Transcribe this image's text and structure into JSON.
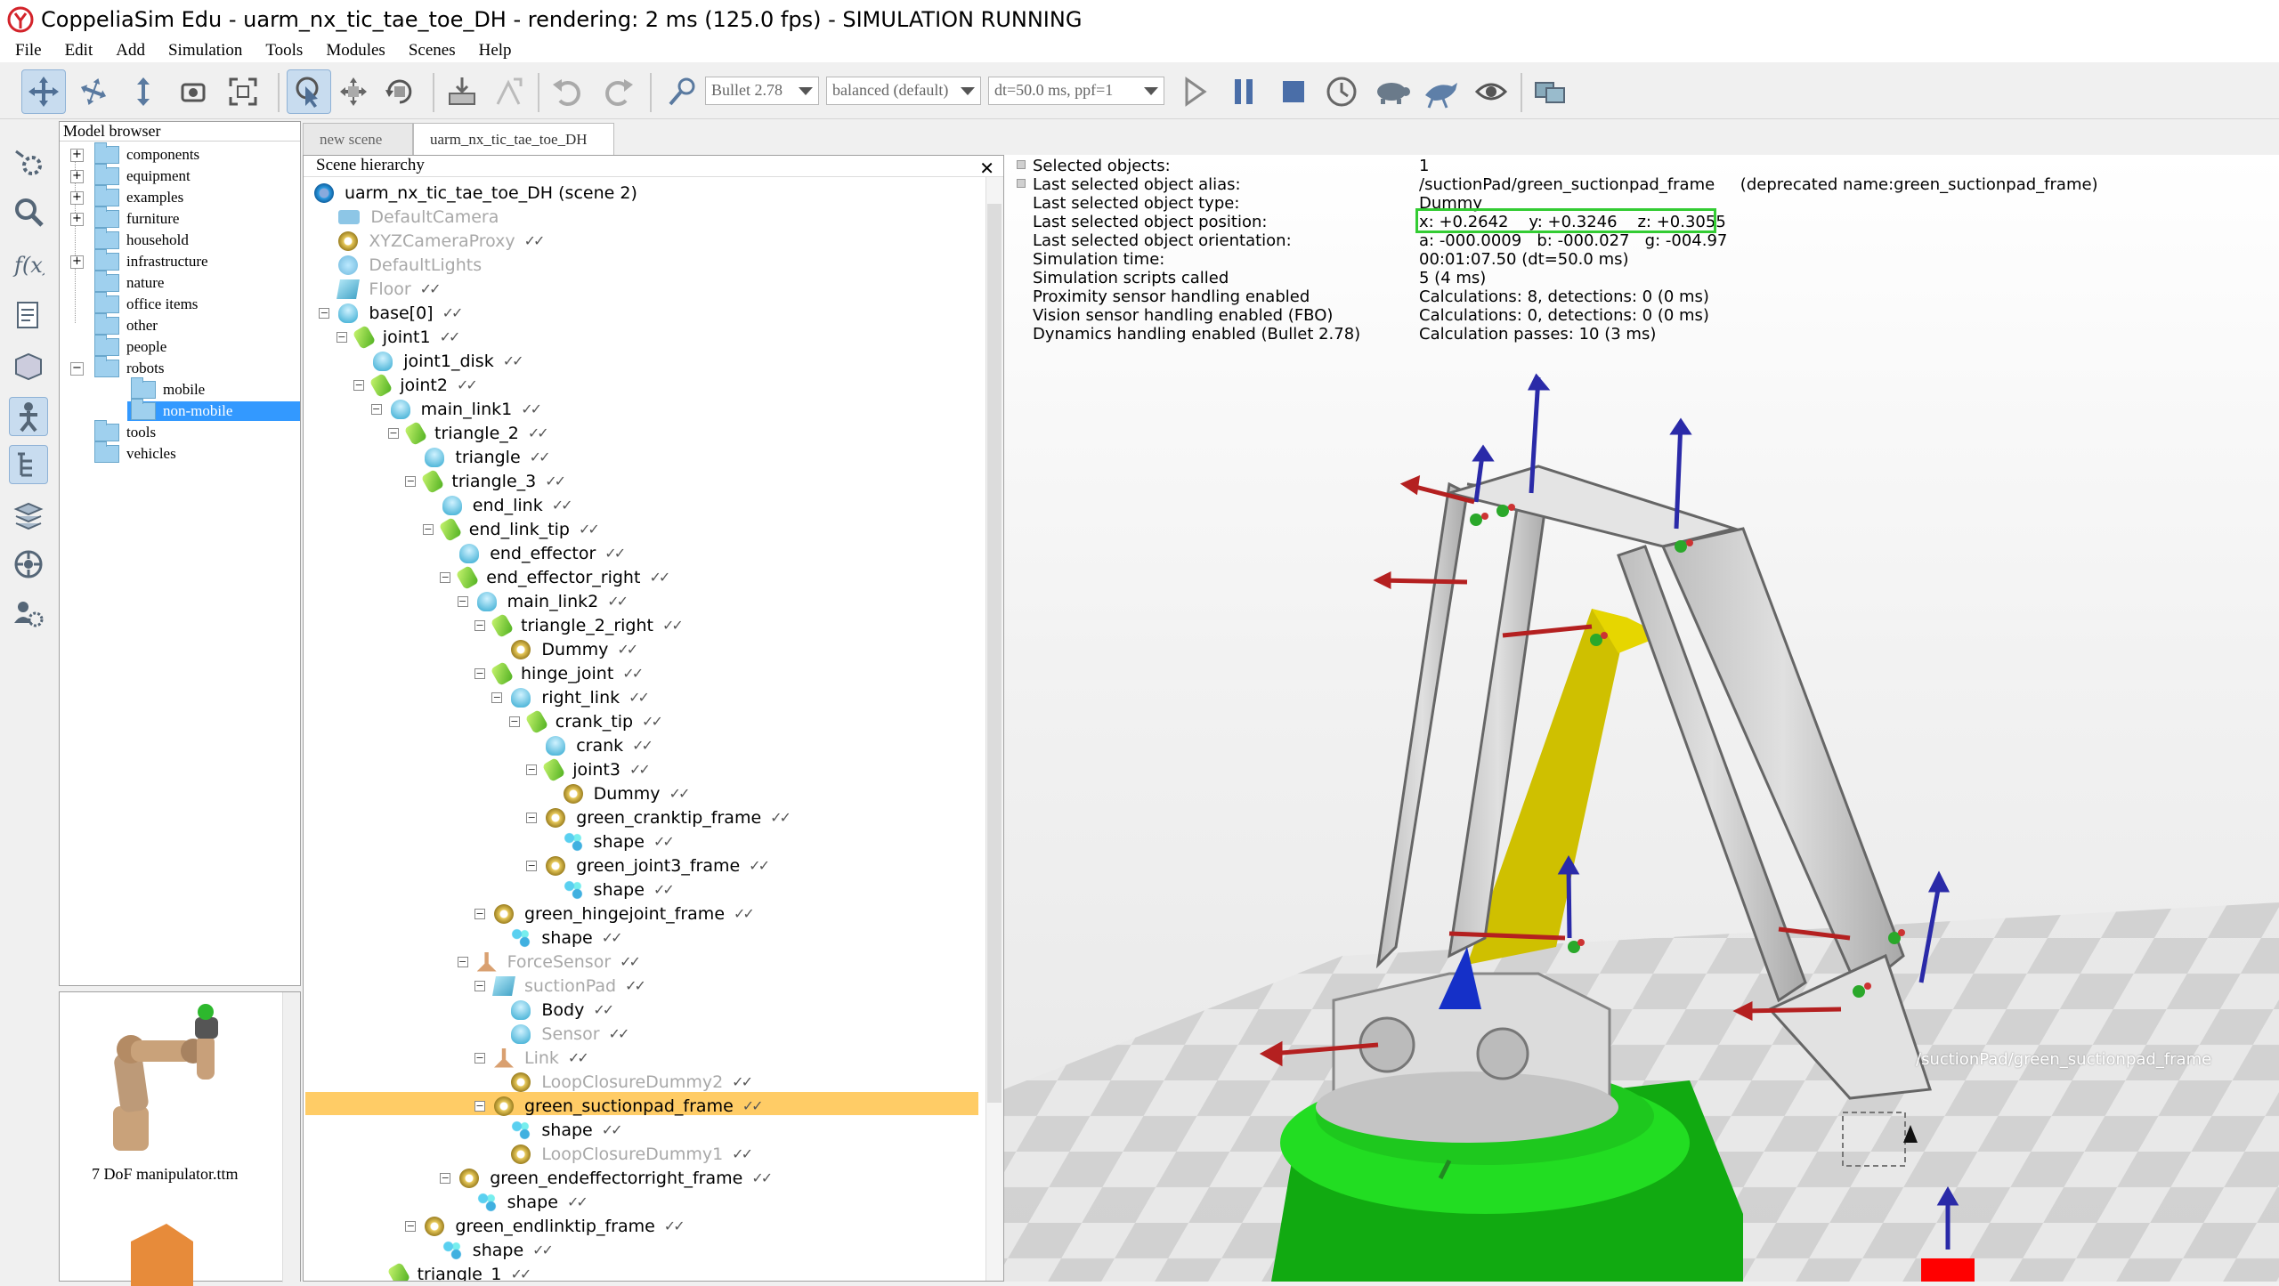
{
  "window": {
    "title": "CoppeliaSim Edu - uarm_nx_tic_tae_toe_DH - rendering: 2 ms (125.0 fps) - SIMULATION RUNNING"
  },
  "menu": [
    "File",
    "Edit",
    "Add",
    "Simulation",
    "Tools",
    "Modules",
    "Scenes",
    "Help"
  ],
  "toolbar": {
    "engine": "Bullet 2.78",
    "accuracy": "balanced (default)",
    "timestep": "dt=50.0 ms, ppf=1",
    "icons": [
      "camera-pan-icon",
      "camera-rotate-icon",
      "camera-shift-icon",
      "camera-angle-icon",
      "camera-fit-icon",
      "click-select-icon",
      "object-shift-icon",
      "object-rotate-icon",
      "assemble-icon",
      "transfer-dna-icon",
      "undo-icon",
      "redo-icon",
      "dynamics-content-icon",
      "play-icon",
      "pause-icon",
      "stop-icon",
      "real-time-icon",
      "slow-down-icon",
      "speed-up-icon",
      "visualization-toggle-icon",
      "page-selector-icon"
    ]
  },
  "model_browser": {
    "title": "Model browser",
    "items": [
      {
        "label": "components",
        "expandable": true
      },
      {
        "label": "equipment",
        "expandable": true
      },
      {
        "label": "examples",
        "expandable": true
      },
      {
        "label": "furniture",
        "expandable": true
      },
      {
        "label": "household",
        "expandable": false
      },
      {
        "label": "infrastructure",
        "expandable": true
      },
      {
        "label": "nature",
        "expandable": false
      },
      {
        "label": "office items",
        "expandable": false
      },
      {
        "label": "other",
        "expandable": false
      },
      {
        "label": "people",
        "expandable": false
      },
      {
        "label": "robots",
        "expandable": true
      },
      {
        "label": "mobile",
        "expandable": false
      },
      {
        "label": "non-mobile",
        "expandable": false
      },
      {
        "label": "tools",
        "expandable": false
      },
      {
        "label": "vehicles",
        "expandable": false
      }
    ],
    "selected": "non-mobile",
    "thumbnail_label": "7 DoF manipulator.ttm"
  },
  "scene_tabs": [
    "new scene",
    "uarm_nx_tic_tae_toe_DH"
  ],
  "scene_hierarchy": {
    "title": "Scene hierarchy",
    "rows": [
      {
        "label": "uarm_nx_tic_tae_toe_DH (scene 2)",
        "depth": 0,
        "icon": "scene",
        "dim": false
      },
      {
        "label": "DefaultCamera",
        "depth": 1,
        "icon": "cam",
        "dim": true
      },
      {
        "label": "XYZCameraProxy",
        "depth": 1,
        "icon": "dummy",
        "dim": true
      },
      {
        "label": "DefaultLights",
        "depth": 1,
        "icon": "light",
        "dim": true
      },
      {
        "label": "Floor",
        "depth": 1,
        "icon": "floor",
        "dim": true
      },
      {
        "label": "base[0]",
        "depth": 1,
        "icon": "shape",
        "dim": false
      },
      {
        "label": "joint1",
        "depth": 2,
        "icon": "joint",
        "dim": false
      },
      {
        "label": "joint1_disk",
        "depth": 3,
        "icon": "shape",
        "dim": false
      },
      {
        "label": "joint2",
        "depth": 3,
        "icon": "joint",
        "dim": false
      },
      {
        "label": "main_link1",
        "depth": 4,
        "icon": "shape",
        "dim": false
      },
      {
        "label": "triangle_2",
        "depth": 5,
        "icon": "joint",
        "dim": false
      },
      {
        "label": "triangle",
        "depth": 6,
        "icon": "shape",
        "dim": false
      },
      {
        "label": "triangle_3",
        "depth": 6,
        "icon": "joint",
        "dim": false
      },
      {
        "label": "end_link",
        "depth": 7,
        "icon": "shape",
        "dim": false
      },
      {
        "label": "end_link_tip",
        "depth": 7,
        "icon": "joint",
        "dim": false
      },
      {
        "label": "end_effector",
        "depth": 8,
        "icon": "shape",
        "dim": false
      },
      {
        "label": "end_effector_right",
        "depth": 8,
        "icon": "joint",
        "dim": false
      },
      {
        "label": "main_link2",
        "depth": 9,
        "icon": "shape",
        "dim": false
      },
      {
        "label": "triangle_2_right",
        "depth": 10,
        "icon": "joint",
        "dim": false
      },
      {
        "label": "Dummy",
        "depth": 11,
        "icon": "dummy",
        "dim": false
      },
      {
        "label": "hinge_joint",
        "depth": 10,
        "icon": "joint",
        "dim": false
      },
      {
        "label": "right_link",
        "depth": 11,
        "icon": "shape",
        "dim": false
      },
      {
        "label": "crank_tip",
        "depth": 12,
        "icon": "joint",
        "dim": false
      },
      {
        "label": "crank",
        "depth": 13,
        "icon": "shape",
        "dim": false
      },
      {
        "label": "joint3",
        "depth": 13,
        "icon": "joint",
        "dim": false
      },
      {
        "label": "Dummy",
        "depth": 14,
        "icon": "dummy",
        "dim": false
      },
      {
        "label": "green_cranktip_frame",
        "depth": 13,
        "icon": "dummy",
        "dim": false
      },
      {
        "label": "shape",
        "depth": 14,
        "icon": "multi",
        "dim": false
      },
      {
        "label": "green_joint3_frame",
        "depth": 13,
        "icon": "dummy",
        "dim": false
      },
      {
        "label": "shape",
        "depth": 14,
        "icon": "multi",
        "dim": false
      },
      {
        "label": "green_hingejoint_frame",
        "depth": 10,
        "icon": "dummy",
        "dim": false
      },
      {
        "label": "shape",
        "depth": 11,
        "icon": "multi",
        "dim": false
      },
      {
        "label": "ForceSensor",
        "depth": 9,
        "icon": "force",
        "dim": true
      },
      {
        "label": "suctionPad",
        "depth": 10,
        "icon": "floor",
        "dim": true
      },
      {
        "label": "Body",
        "depth": 11,
        "icon": "shape",
        "dim": false
      },
      {
        "label": "Sensor",
        "depth": 11,
        "icon": "shape",
        "dim": true
      },
      {
        "label": "Link",
        "depth": 10,
        "icon": "force",
        "dim": true
      },
      {
        "label": "LoopClosureDummy2",
        "depth": 11,
        "icon": "dummy",
        "dim": true
      },
      {
        "label": "green_suctionpad_frame",
        "depth": 10,
        "icon": "dummy",
        "dim": false
      },
      {
        "label": "shape",
        "depth": 11,
        "icon": "multi",
        "dim": false
      },
      {
        "label": "LoopClosureDummy1",
        "depth": 11,
        "icon": "dummy",
        "dim": true
      },
      {
        "label": "green_endeffectorright_frame",
        "depth": 8,
        "icon": "dummy",
        "dim": false
      },
      {
        "label": "shape",
        "depth": 9,
        "icon": "multi",
        "dim": false
      },
      {
        "label": "green_endlinktip_frame",
        "depth": 6,
        "icon": "dummy",
        "dim": false
      },
      {
        "label": "shape",
        "depth": 7,
        "icon": "multi",
        "dim": false
      },
      {
        "label": "triangle_1",
        "depth": 4,
        "icon": "joint",
        "dim": false
      }
    ],
    "selected_index": 38
  },
  "info": {
    "labels": [
      "Selected objects:",
      "Last selected object alias:",
      "Last selected object type:",
      "Last selected object position:",
      "Last selected object orientation:",
      "Simulation time:",
      "Simulation scripts called",
      "Proximity sensor handling enabled",
      "Vision sensor handling enabled (FBO)",
      "Dynamics handling enabled (Bullet 2.78)"
    ],
    "values": [
      "1",
      "/suctionPad/green_suctionpad_frame     (deprecated name:green_suctionpad_frame)",
      "Dummy",
      "x: +0.2642    y: +0.3246    z: +0.3055",
      "a: -000.0009   b: -000.027   g: -004.97",
      "00:01:07.50 (dt=50.0 ms)",
      "5 (4 ms)",
      "Calculations: 8, detections: 0 (0 ms)",
      "Calculations: 0, detections: 0 (0 ms)",
      "Calculation passes: 10 (3 ms)"
    ]
  },
  "viewport_label": "/suctionPad/green_suctionpad_frame",
  "colors": {
    "highlight": "#ffcc66",
    "green_box": "#33cc33",
    "arm_yellow": "#d4c800",
    "base_green": "#22dd22"
  }
}
